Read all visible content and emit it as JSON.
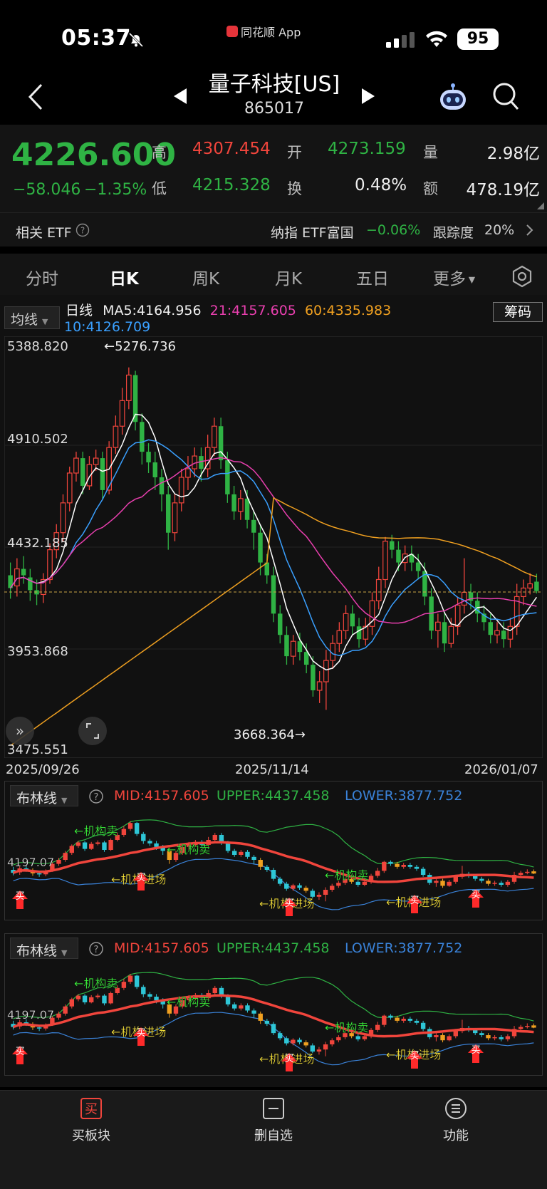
{
  "status_bar": {
    "time": "05:37",
    "app_name": "同花顺 App",
    "battery": "95"
  },
  "nav": {
    "title": "量子科技[US]",
    "code": "865017"
  },
  "quote": {
    "price": "4226.600",
    "change": "−58.046",
    "change_pct": "−1.35%",
    "high_label": "高",
    "high": "4307.454",
    "open_label": "开",
    "open": "4273.159",
    "vol_label": "量",
    "vol": "2.98亿",
    "low_label": "低",
    "low": "4215.328",
    "turnover_label": "换",
    "turnover": "0.48%",
    "amount_label": "额",
    "amount": "478.19亿"
  },
  "etf": {
    "label": "相关 ETF",
    "name": "纳指 ETF富国",
    "change": "−0.06%",
    "track_label": "跟踪度",
    "track": "20%"
  },
  "tabs": [
    "分时",
    "日K",
    "周K",
    "月K",
    "五日",
    "更多"
  ],
  "active_tab": "日K",
  "kline": {
    "indicator_select": "均线",
    "period_label": "日线",
    "ma5": "MA5:4164.956",
    "ma21": "21:4157.605",
    "ma60": "60:4335.983",
    "ma10": "10:4126.709",
    "chips_button": "筹码",
    "y_labels": [
      "5388.820",
      "4910.502",
      "4432.185",
      "3953.868",
      "3475.551"
    ],
    "high_mark": "←5276.736",
    "low_mark": "3668.364→",
    "x_labels": [
      "2025/09/26",
      "2025/11/14",
      "2026/01/07"
    ],
    "colors": {
      "up": "#f0453c",
      "down": "#2fb344",
      "ma5": "#ffffff",
      "ma10": "#3aa0ff",
      "ma21": "#e83fae",
      "ma60": "#f0a020"
    }
  },
  "chart_data": {
    "type": "candlestick",
    "ylim": [
      3475.551,
      5388.82
    ],
    "high": 5276.736,
    "low": 3668.364,
    "x_start": "2025/09/26",
    "x_mid": "2025/11/14",
    "x_end": "2026/01/07",
    "candles": [
      [
        4300,
        4240,
        4360,
        4190
      ],
      [
        4250,
        4330,
        4380,
        4200
      ],
      [
        4330,
        4300,
        4390,
        4260
      ],
      [
        4290,
        4230,
        4330,
        4180
      ],
      [
        4230,
        4210,
        4280,
        4160
      ],
      [
        4210,
        4280,
        4310,
        4170
      ],
      [
        4280,
        4420,
        4450,
        4260
      ],
      [
        4420,
        4500,
        4540,
        4380
      ],
      [
        4500,
        4640,
        4680,
        4460
      ],
      [
        4640,
        4780,
        4810,
        4600
      ],
      [
        4780,
        4850,
        4880,
        4740
      ],
      [
        4850,
        4720,
        4880,
        4680
      ],
      [
        4720,
        4820,
        4860,
        4700
      ],
      [
        4820,
        4850,
        4890,
        4790
      ],
      [
        4850,
        4700,
        4880,
        4660
      ],
      [
        4700,
        4900,
        4930,
        4680
      ],
      [
        4900,
        5000,
        5050,
        4870
      ],
      [
        5000,
        5120,
        5180,
        4960
      ],
      [
        5120,
        5240,
        5276,
        5080
      ],
      [
        5240,
        5020,
        5260,
        4980
      ],
      [
        5020,
        4880,
        5060,
        4820
      ],
      [
        4880,
        4830,
        4920,
        4780
      ],
      [
        4830,
        4760,
        4880,
        4700
      ],
      [
        4760,
        4680,
        4800,
        4600
      ],
      [
        4680,
        4500,
        4720,
        4420
      ],
      [
        4500,
        4640,
        4680,
        4460
      ],
      [
        4640,
        4760,
        4800,
        4600
      ],
      [
        4760,
        4800,
        4860,
        4700
      ],
      [
        4800,
        4860,
        4900,
        4760
      ],
      [
        4860,
        4800,
        4900,
        4740
      ],
      [
        4800,
        4900,
        4960,
        4760
      ],
      [
        4900,
        5000,
        5040,
        4860
      ],
      [
        5000,
        4840,
        5040,
        4800
      ],
      [
        4840,
        4680,
        4880,
        4640
      ],
      [
        4680,
        4600,
        4720,
        4560
      ],
      [
        4600,
        4660,
        4700,
        4560
      ],
      [
        4660,
        4560,
        4700,
        4520
      ],
      [
        4560,
        4500,
        4600,
        4420
      ],
      [
        4500,
        4360,
        4540,
        4300
      ],
      [
        4360,
        4300,
        4400,
        4260
      ],
      [
        4300,
        4120,
        4340,
        4080
      ],
      [
        4120,
        4020,
        4160,
        3980
      ],
      [
        4020,
        3920,
        4060,
        3880
      ],
      [
        3920,
        3990,
        4020,
        3880
      ],
      [
        3990,
        3940,
        4030,
        3900
      ],
      [
        3940,
        3880,
        3980,
        3840
      ],
      [
        3880,
        3760,
        3920,
        3730
      ],
      [
        3760,
        3800,
        3850,
        3700
      ],
      [
        3800,
        3900,
        3950,
        3668
      ],
      [
        3900,
        3980,
        4020,
        3860
      ],
      [
        3980,
        4040,
        4080,
        3940
      ],
      [
        4040,
        4120,
        4160,
        4000
      ],
      [
        4120,
        4060,
        4160,
        4020
      ],
      [
        4060,
        4000,
        4100,
        3960
      ],
      [
        4000,
        4060,
        4100,
        3970
      ],
      [
        4060,
        4180,
        4220,
        4020
      ],
      [
        4180,
        4280,
        4340,
        4140
      ],
      [
        4280,
        4460,
        4480,
        4240
      ],
      [
        4460,
        4420,
        4490,
        4380
      ],
      [
        4420,
        4360,
        4460,
        4320
      ],
      [
        4360,
        4400,
        4440,
        4320
      ],
      [
        4400,
        4360,
        4440,
        4320
      ],
      [
        4360,
        4320,
        4400,
        4280
      ],
      [
        4320,
        4200,
        4360,
        4160
      ],
      [
        4200,
        4040,
        4240,
        4000
      ],
      [
        4040,
        4080,
        4120,
        3960
      ],
      [
        4080,
        3980,
        4120,
        3940
      ],
      [
        3980,
        4060,
        4100,
        3960
      ],
      [
        4060,
        4160,
        4200,
        4020
      ],
      [
        4160,
        4220,
        4380,
        4120
      ],
      [
        4220,
        4180,
        4260,
        4140
      ],
      [
        4180,
        4120,
        4220,
        4080
      ],
      [
        4120,
        4080,
        4160,
        4040
      ],
      [
        4080,
        4020,
        4120,
        3980
      ],
      [
        4020,
        4040,
        4080,
        3980
      ],
      [
        4040,
        4000,
        4080,
        3960
      ],
      [
        4000,
        4060,
        4100,
        3960
      ],
      [
        4060,
        4200,
        4260,
        4020
      ],
      [
        4200,
        4240,
        4280,
        4160
      ],
      [
        4240,
        4260,
        4310,
        4210
      ],
      [
        4270,
        4226,
        4307,
        4215
      ]
    ],
    "series": [
      "MA5",
      "MA10",
      "21",
      "60"
    ]
  },
  "boll": {
    "select": "布林线",
    "mid": "MID:4157.605",
    "upper": "UPPER:4437.458",
    "lower": "LOWER:3877.752",
    "y_label": "4197.07",
    "signals": {
      "buy": "买",
      "sell": "←机构卖",
      "enter": "←机构进场",
      "sell2": "←机构卖",
      "enter2": "机构进场"
    }
  },
  "bottom": [
    {
      "label": "买板块",
      "icon": "buy-icon"
    },
    {
      "label": "删自选",
      "icon": "remove-watchlist-icon"
    },
    {
      "label": "功能",
      "icon": "menu-icon"
    }
  ]
}
